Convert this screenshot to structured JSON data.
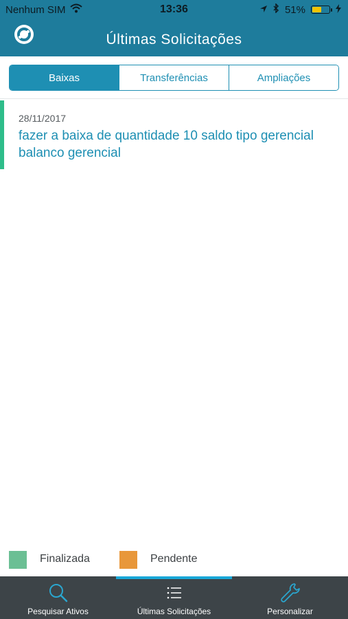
{
  "status_bar": {
    "carrier": "Nenhum SIM",
    "time": "13:36",
    "battery_percent_text": "51%",
    "battery_level": 0.51
  },
  "header": {
    "title": "Últimas Solicitações"
  },
  "segments": [
    {
      "label": "Baixas",
      "active": true
    },
    {
      "label": "Transferências",
      "active": false
    },
    {
      "label": "Ampliações",
      "active": false
    }
  ],
  "items": [
    {
      "date": "28/11/2017",
      "description": "fazer a baixa de quantidade 10 saldo tipo gerencial balanco gerencial",
      "status_color": "#2ebd8a"
    }
  ],
  "legend": [
    {
      "label": "Finalizada",
      "color": "#6bbf94"
    },
    {
      "label": "Pendente",
      "color": "#e8973a"
    }
  ],
  "tabbar": [
    {
      "label": "Pesquisar Ativos",
      "icon": "search-icon",
      "active": false
    },
    {
      "label": "Últimas Solicitações",
      "icon": "list-icon",
      "active": true
    },
    {
      "label": "Personalizar",
      "icon": "wrench-icon",
      "active": false
    }
  ],
  "colors": {
    "header": "#1e7c9c",
    "accent": "#1e8fb3",
    "tabbar": "#3d4448",
    "tab_indicator": "#19a8d8"
  }
}
